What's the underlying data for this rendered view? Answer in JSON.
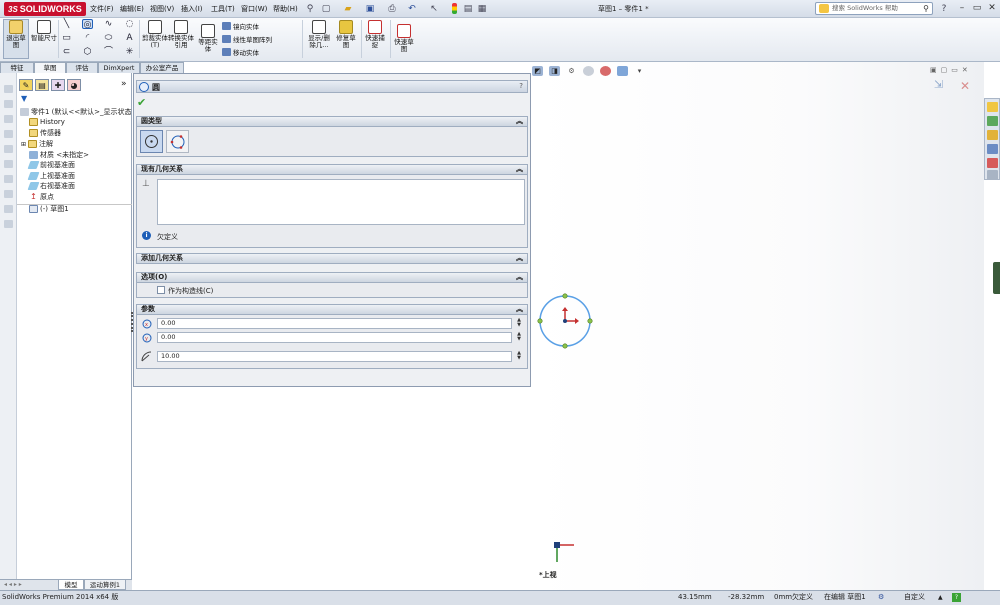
{
  "app": {
    "brand": "SOLIDWORKS",
    "doc_title": "草图1 – 零件1 *"
  },
  "menu": [
    {
      "label": "文件(F)"
    },
    {
      "label": "编辑(E)"
    },
    {
      "label": "视图(V)"
    },
    {
      "label": "插入(I)"
    },
    {
      "label": "工具(T)"
    },
    {
      "label": "窗口(W)"
    },
    {
      "label": "帮助(H)"
    }
  ],
  "search": {
    "placeholder": "搜索 SolidWorks 帮助"
  },
  "ribbon": {
    "exit_sketch": "退出草图",
    "smart_dim": "智能尺寸",
    "trim": "剪裁实体(T)",
    "convert": "转换实体引用",
    "offset": "等距实体",
    "mirror": "镜向实体",
    "linear_pattern": "线性草图阵列",
    "move": "移动实体",
    "show_relations": "显示/删除几...",
    "repair": "修复草图",
    "quick_snap": "快速捕捉",
    "rapid_sketch": "快速草图"
  },
  "tabs": [
    {
      "label": "特征"
    },
    {
      "label": "草图"
    },
    {
      "label": "评估"
    },
    {
      "label": "DimXpert"
    },
    {
      "label": "办公室产品"
    }
  ],
  "tree": {
    "root": "零件1 (默认<<默认>_显示状态",
    "items": [
      {
        "label": "History"
      },
      {
        "label": "传感器"
      },
      {
        "label": "注解"
      },
      {
        "label": "材质 <未指定>"
      },
      {
        "label": "前视基准面"
      },
      {
        "label": "上视基准面"
      },
      {
        "label": "右视基准面"
      },
      {
        "label": "原点"
      },
      {
        "label": "(-) 草图1"
      }
    ],
    "bottom_tabs": [
      {
        "label": "模型"
      },
      {
        "label": "运动算例1"
      }
    ]
  },
  "pm": {
    "title": "圆",
    "sections": {
      "circle_type": "圆类型",
      "existing_relations": "现有几何关系",
      "add_relations": "添加几何关系",
      "options": "选项(O)",
      "parameters": "参数"
    },
    "status_text": "欠定义",
    "construction_label": "作为构造线(C)",
    "construction_checked": false,
    "params": {
      "cx": "0.00",
      "cy": "0.00",
      "radius": "10.00"
    }
  },
  "viewport": {
    "view_label": "*上视"
  },
  "status": {
    "product": "SolidWorks Premium 2014 x64 版",
    "x": "43.15mm",
    "y": "-28.32mm",
    "z": "0mm",
    "define": "欠定义",
    "editing": "在编辑 草图1",
    "custom": "自定义"
  },
  "colors": {
    "accent": "#1f5fb8",
    "circle": "#5aa0e6",
    "handle": "#8bc34a"
  }
}
